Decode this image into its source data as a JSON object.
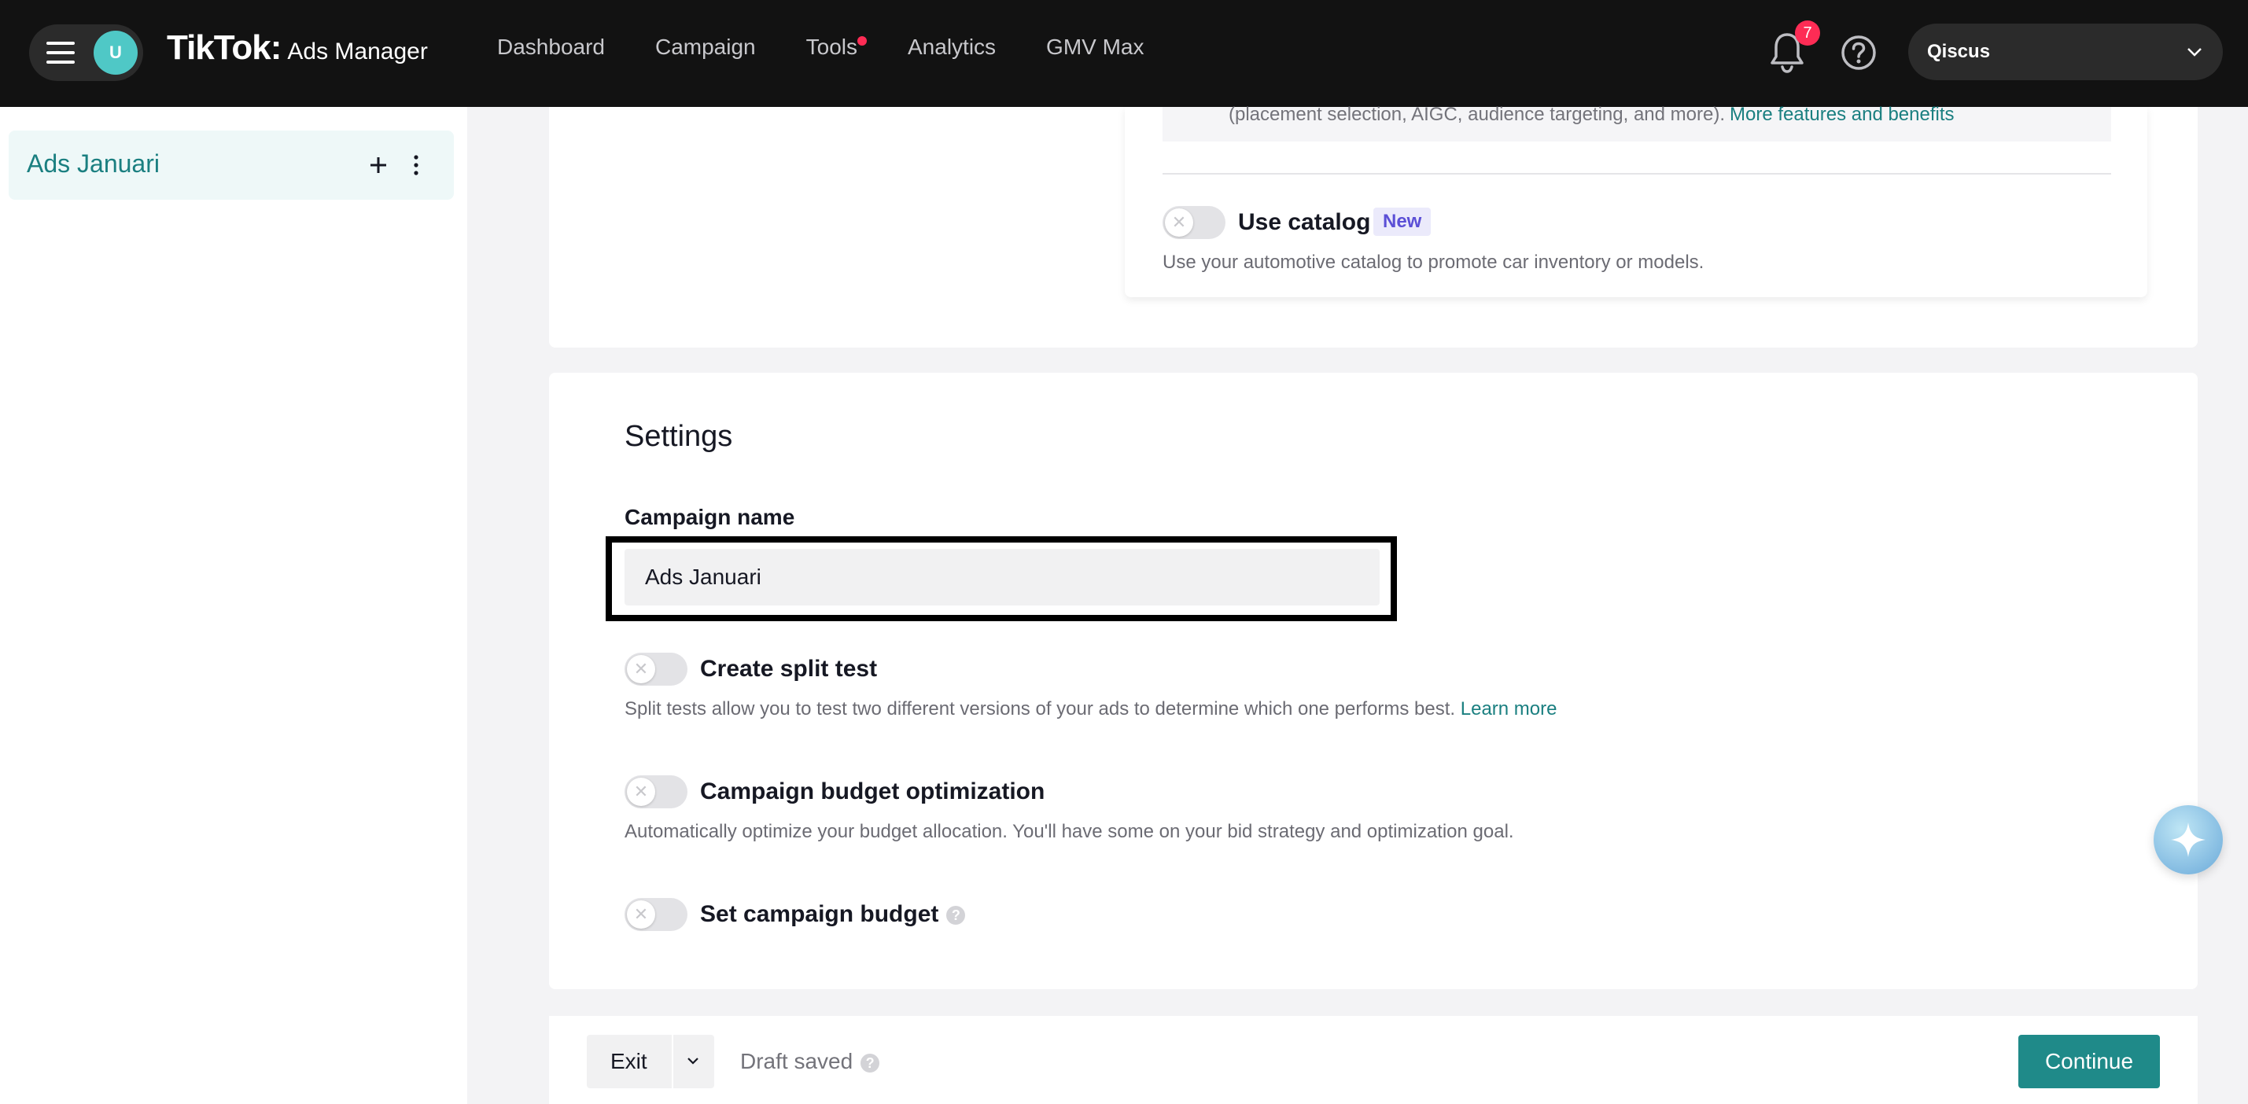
{
  "topbar": {
    "avatar_initial": "U",
    "logo_main": "TikTok:",
    "logo_sub": "Ads Manager",
    "nav": [
      "Dashboard",
      "Campaign",
      "Tools",
      "Analytics",
      "GMV Max"
    ],
    "notification_count": "7",
    "account_name": "Qiscus"
  },
  "sidebar": {
    "item_label": "Ads Januari"
  },
  "top_card": {
    "info_text": "(placement selection, AIGC, audience targeting, and more).",
    "info_link": "More features and benefits",
    "catalog_label": "Use catalog",
    "catalog_badge": "New",
    "catalog_helper": "Use your automotive catalog to promote car inventory or models."
  },
  "settings": {
    "title": "Settings",
    "campaign_name_label": "Campaign name",
    "campaign_name_value": "Ads Januari",
    "split_test_label": "Create split test",
    "split_test_helper": "Split tests allow you to test two different versions of your ads to determine which one performs best.",
    "split_test_link": "Learn more",
    "cbo_label": "Campaign budget optimization",
    "cbo_helper": "Automatically optimize your budget allocation. You'll have some on your bid strategy and optimization goal.",
    "budget_label": "Set campaign budget"
  },
  "footer": {
    "exit_label": "Exit",
    "draft_status": "Draft saved",
    "continue_label": "Continue"
  },
  "colors": {
    "accent": "#1f8a89",
    "topbar": "#121212",
    "badge": "#fe2c55"
  }
}
